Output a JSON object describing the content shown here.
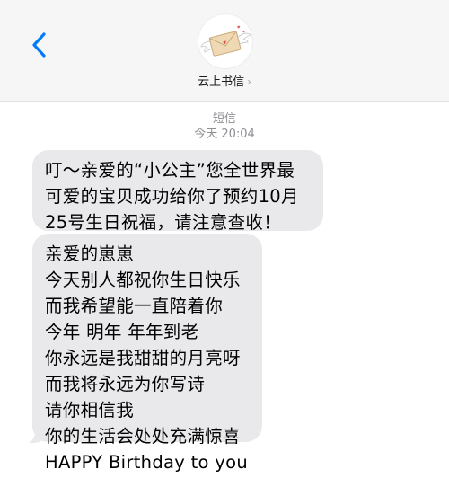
{
  "header": {
    "contact_name": "云上书信",
    "chevron": "›",
    "back_icon": "chevron-left-icon",
    "avatar_icon": "winged-envelope-icon"
  },
  "thread": {
    "message_type": "短信",
    "timestamp": "今天 20:04"
  },
  "messages": [
    {
      "lines": [
        "叮～亲爱的“小公主”您全世界最",
        "可爱的宝贝成功给你了预约10月",
        "25号生日祝福，请注意查收！"
      ]
    },
    {
      "lines": [
        "亲爱的崽崽",
        "今天别人都祝你生日快乐",
        "而我希望能一直陪着你",
        "今年 明年 年年到老",
        "你永远是我甜甜的月亮呀",
        "而我将永远为你写诗",
        "请你相信我",
        "你的生活会处处充满惊喜",
        "HAPPY Birthday to you"
      ]
    }
  ],
  "colors": {
    "accent": "#007aff",
    "bubble": "#e9e9eb",
    "header_bg": "#f6f6f6",
    "meta_text": "#8e8e93"
  }
}
